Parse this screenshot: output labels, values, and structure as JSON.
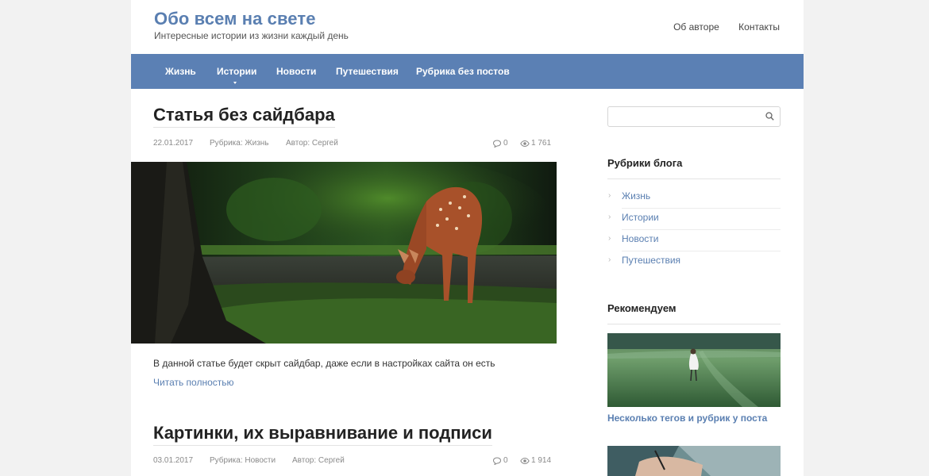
{
  "header": {
    "site_title": "Обо всем на свете",
    "site_description": "Интересные истории из жизни каждый день",
    "top_menu": [
      "Об авторе",
      "Контакты"
    ]
  },
  "nav": {
    "items": [
      "Жизнь",
      "Истории",
      "Новости",
      "Путешествия",
      "Рубрика без постов"
    ]
  },
  "posts": [
    {
      "title": "Статья без сайдбара",
      "date": "22.01.2017",
      "category": "Рубрика: Жизнь",
      "author": "Автор: Сергей",
      "comments": "0",
      "views": "1 761",
      "excerpt": "В данной статье будет скрыт сайдбар, даже если в настройках сайта он есть",
      "read_more": "Читать полностью"
    },
    {
      "title": "Картинки, их выравнивание и подписи",
      "date": "03.01.2017",
      "category": "Рубрика: Новости",
      "author": "Автор: Сергей",
      "comments": "0",
      "views": "1 914"
    }
  ],
  "sidebar": {
    "search_placeholder": "",
    "categories_title": "Рубрики блога",
    "categories": [
      "Жизнь",
      "Истории",
      "Новости",
      "Путешествия"
    ],
    "recommend_title": "Рекомендуем",
    "recommend_items": [
      "Несколько тегов и рубрик у поста"
    ]
  },
  "colors": {
    "accent": "#5a7fb1",
    "nav_bg": "#5b80b4",
    "page_bg": "#f2f2f2"
  },
  "icons": [
    "search-icon",
    "comment-icon",
    "eye-icon",
    "chevron-right-icon",
    "caret-down-icon"
  ]
}
